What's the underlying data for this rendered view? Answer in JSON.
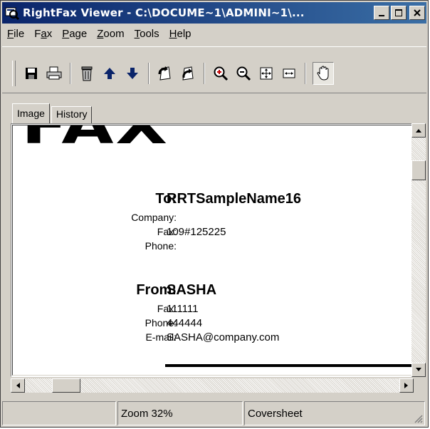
{
  "window": {
    "title": "RightFax Viewer - C:\\DOCUME~1\\ADMINI~1\\...",
    "buttons": [
      "_",
      "□",
      "×"
    ]
  },
  "menu": [
    {
      "label": "File",
      "u": "F",
      "rest": "ile"
    },
    {
      "label": "Fax",
      "pre": "F",
      "u": "a",
      "rest": "x"
    },
    {
      "label": "Page",
      "u": "P",
      "rest": "age"
    },
    {
      "label": "Zoom",
      "u": "Z",
      "rest": "oom"
    },
    {
      "label": "Tools",
      "u": "T",
      "rest": "ools"
    },
    {
      "label": "Help",
      "u": "H",
      "rest": "elp"
    }
  ],
  "toolbar": {
    "icons": [
      "save-icon",
      "print-icon",
      "delete-icon",
      "previous-page-icon",
      "next-page-icon",
      "rotate-left-icon",
      "rotate-right-icon",
      "zoom-in-icon",
      "zoom-out-icon",
      "fit-page-icon",
      "fit-width-icon",
      "hand-tool-icon"
    ]
  },
  "tabs": {
    "image": "Image",
    "history": "History"
  },
  "document": {
    "logo": "FAX",
    "to_label": "To:",
    "to_value": "RRTSampleName16",
    "company_label": "Company:",
    "company_value": "",
    "to_fax_label": "Fax:",
    "to_fax_value": "109#125225",
    "to_phone_label": "Phone:",
    "to_phone_value": "",
    "from_label": "From:",
    "from_value": "SASHA",
    "from_fax_label": "Fax:",
    "from_fax_value": "111111",
    "from_phone_label": "Phone:",
    "from_phone_value": "444444",
    "email_label": "E-mail:",
    "email_value": "SASHA@company.com"
  },
  "status": {
    "pane1": "",
    "zoom": "Zoom 32%",
    "page_type": "Coversheet"
  }
}
